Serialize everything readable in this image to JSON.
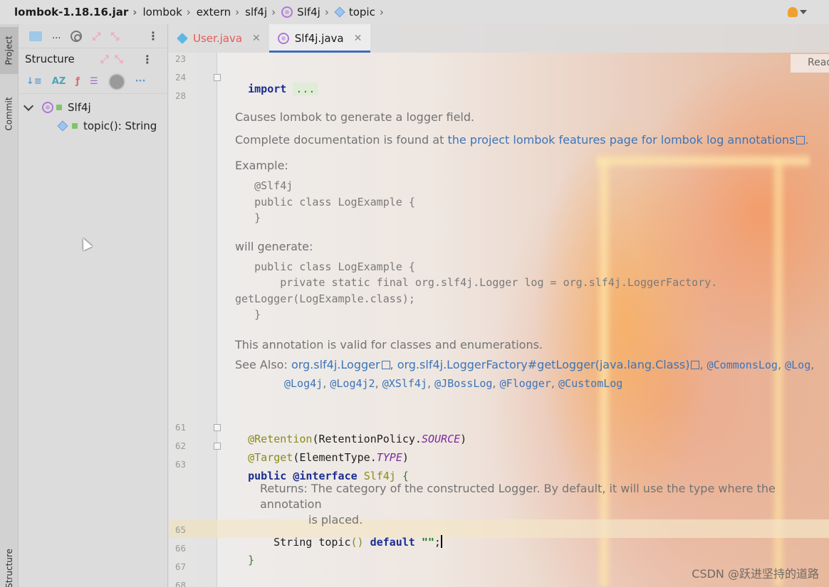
{
  "breadcrumb": {
    "items": [
      "lombok-1.18.16.jar",
      "lombok",
      "extern",
      "slf4j",
      "Slf4j",
      "topic"
    ]
  },
  "toolstrip": {
    "project_label": "Project",
    "commit_label": "Commit",
    "structure_label": "Structure"
  },
  "project_panel": {
    "truncated_label": "..."
  },
  "structure_panel": {
    "title": "Structure",
    "tree": {
      "root": "Slf4j",
      "child": "topic(): String"
    }
  },
  "tabs": [
    {
      "label": "User.java",
      "active": false
    },
    {
      "label": "Slf4j.java",
      "active": true
    }
  ],
  "reader_mode_label": "Read",
  "gutter": {
    "lines": [
      "23",
      "24",
      "28",
      "61",
      "62",
      "63",
      "65",
      "66",
      "67",
      "68"
    ]
  },
  "code": {
    "import_kw": "import",
    "import_fold": "...",
    "retention_ann": "@Retention",
    "retention_arg_cls": "RetentionPolicy.",
    "retention_arg_val": "SOURCE",
    "target_ann": "@Target",
    "target_arg_cls": "ElementType.",
    "target_arg_val": "TYPE",
    "public_kw": "public",
    "interface_kw": "@interface",
    "interface_name": "Slf4j",
    "open_brace": "{",
    "method_type": "String",
    "method_name": "topic",
    "method_parens": "()",
    "default_kw": "default",
    "default_val": "\"\"",
    "semicolon": ";",
    "close_brace": "}"
  },
  "doc": {
    "p1": "Causes lombok to generate a logger field.",
    "p2_text": "Complete documentation is found at ",
    "p2_link": "the project lombok features page for lombok log annotations",
    "p2_end": ".",
    "example_label": "Example:",
    "example_code": "   @Slf4j\n   public class LogExample {\n   }",
    "will_generate_label": "will generate:",
    "generate_code": "   public class LogExample {\n       private static final org.slf4j.Logger log = org.slf4j.LoggerFactory.\ngetLogger(LogExample.class);\n   }",
    "valid_text": "This annotation is valid for classes and enumerations.",
    "see_also_label": "See Also:",
    "see_also_1": "org.slf4j.Logger",
    "see_also_2": "org.slf4j.LoggerFactory#getLogger(java.lang.Class)",
    "see_also_3": "@CommonsLog",
    "see_also_4": "@Log",
    "see_also_5": "@Log4j",
    "see_also_6": "@Log4j2",
    "see_also_7": "@XSlf4j",
    "see_also_8": "@JBossLog",
    "see_also_9": "@Flogger",
    "see_also_10": "@CustomLog"
  },
  "returns": {
    "label": "Returns:",
    "text": "The category of the constructed Logger. By default, it will use the type where the annotation",
    "text2": "is placed."
  },
  "watermark": "CSDN @跃进坚持的道路",
  "colors": {
    "accent": "#3f6bbd",
    "keyword": "#1b2d8f",
    "annotation": "#8a8a1a",
    "link": "#3d74b8",
    "error_tab": "#e45a5a"
  }
}
